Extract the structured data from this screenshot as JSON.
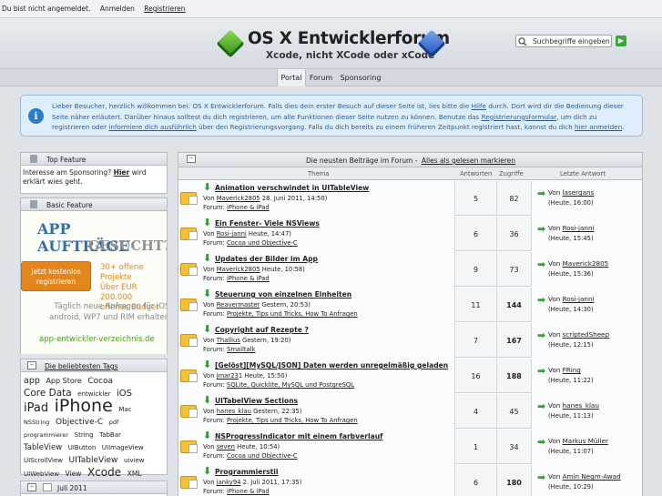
{
  "topbar": {
    "status": "Du bist nicht angemeldet.",
    "login": "Anmelden",
    "register": "Registrieren"
  },
  "header": {
    "title": "OS X Entwicklerforum",
    "subtitle": "Xcode, nicht XCode oder xCode"
  },
  "search": {
    "placeholder": "Suchbegriffe eingeben",
    "go": "▶"
  },
  "nav": {
    "tabs": [
      {
        "label": "Portal"
      },
      {
        "label": "Forum"
      },
      {
        "label": "Sponsoring"
      }
    ]
  },
  "info": {
    "p1": "Lieber Besucher, herzlich willkommen bei: OS X Entwicklerforum. Falls dies dein erster Besuch auf dieser Seite ist, lies bitte die ",
    "help": "Hilfe",
    "p2": " durch. Dort wird dir die Bedienung dieser Seite näher erläutert. Darüber hinaus solltest du dich registrieren, um alle Funktionen dieser Seite nutzen zu können. Benutze das ",
    "form": "Registrierungsformular",
    "p3": ", um dich zu registrieren oder ",
    "more": "informiere dich ausführlich",
    "p4": " über den Registrierungsvorgang. Falls du dich bereits zu einem früheren Zeitpunkt registriert hast, kannst du dich ",
    "login": "hier anmelden",
    "p5": "."
  },
  "sidebar": {
    "top_feature": {
      "title": "Top Feature",
      "text1": "Interesse am Sponsoring? ",
      "link": "Hier",
      "text2": " wird erklärt wies geht."
    },
    "basic_feature": {
      "title": "Basic Feature",
      "ad_line1": "APP AUFTRÄGE",
      "ad_line2": "GESUCHT?",
      "ad_button": "Jetzt kostenlos registrieren",
      "ad_offer1": "30+ offene Projekte",
      "ad_offer2": "Über EUR 200.000",
      "ad_offer3": "offenes Budget",
      "ad_text1": "Täglich neue Anfragen für iOS,",
      "ad_text2": "android, WP7 und RIM erhalten:",
      "ad_url": "app-entwickler-verzeichnis.de"
    },
    "tags": {
      "title": "Die beliebtesten Tags",
      "items": [
        {
          "t": "app",
          "s": 9.5
        },
        {
          "t": "App Store",
          "s": 8
        },
        {
          "t": "Cocoa",
          "s": 9
        },
        {
          "t": "Core Data",
          "s": 10.5
        },
        {
          "t": "entwickler",
          "s": 7
        },
        {
          "t": "iOS",
          "s": 10
        },
        {
          "t": "iPad",
          "s": 13
        },
        {
          "t": "iPhone",
          "s": 19
        },
        {
          "t": "Mac",
          "s": 7
        },
        {
          "t": "NSString",
          "s": 6.5
        },
        {
          "t": "Objective-C",
          "s": 9
        },
        {
          "t": "pdf",
          "s": 6.5
        },
        {
          "t": "programmierer",
          "s": 6.5
        },
        {
          "t": "String",
          "s": 7
        },
        {
          "t": "TabBar",
          "s": 7
        },
        {
          "t": "TableView",
          "s": 8.5
        },
        {
          "t": "UIButton",
          "s": 7
        },
        {
          "t": "UIImageView",
          "s": 7
        },
        {
          "t": "UIScrollView",
          "s": 7
        },
        {
          "t": "UITableView",
          "s": 9
        },
        {
          "t": "uiview",
          "s": 7
        },
        {
          "t": "UIWebView",
          "s": 7
        },
        {
          "t": "View",
          "s": 7.5
        },
        {
          "t": "Xcode",
          "s": 12
        },
        {
          "t": "XML",
          "s": 7.5
        }
      ]
    },
    "calendar": {
      "title": "Juli 2011"
    }
  },
  "main": {
    "heading": "Die neusten Beiträge im Forum - ",
    "mark_read": "Alles als gelesen markieren",
    "columns": {
      "topic": "Thema",
      "replies": "Antworten",
      "views": "Zugriffe",
      "last": "Letzte Antwort"
    },
    "by": "Von ",
    "forum_label": "Forum: ",
    "rows": [
      {
        "title": "Animation verschwindet in UITableView",
        "author": "Maverick2805",
        "date": " 28. Juni 2011, 14:50)",
        "date_prefix": "",
        "forum": "iPhone & iPad",
        "replies": "5",
        "views": "82",
        "last_by": "lasergans",
        "last_time": "(Heute, 16:00)"
      },
      {
        "title": "Ein Fenster- Viele NSViews",
        "author": "Rosi-janni",
        "date": " Heute, 14:47)",
        "forum": "Cocoa und Objective-C",
        "replies": "6",
        "views": "36",
        "last_by": "Rosi-janni",
        "last_time": "(Heute, 15:45)"
      },
      {
        "title": "Updates der Bilder im App",
        "author": "Maverick2805",
        "date": " Heute, 10:58)",
        "forum": "iPhone & iPad",
        "replies": "9",
        "views": "73",
        "last_by": "Maverick2805",
        "last_time": "(Heute, 15:36)"
      },
      {
        "title": "Steuerung von einzelnen Einheiten",
        "author": "Reavermaster",
        "date": " Gestern, 20:53)",
        "forum": "Projekte, Tips und Tricks, How To Anfragen",
        "replies": "11",
        "views": "144",
        "last_by": "Rosi-janni",
        "last_time": "(Heute, 14:30)"
      },
      {
        "title": "Copyright auf Rezepte ?",
        "author": "Thallius",
        "date": " Gestern, 19:20)",
        "forum": "Smalltalk",
        "replies": "7",
        "views": "167",
        "last_by": "scriptedSheep",
        "last_time": "(Heute, 12:15)"
      },
      {
        "title": "[Gelöst][MySQL/JSON] Daten werden unregelmäßig geladen",
        "author": "jmar23",
        "date": "1 Heute, 15:50)",
        "forum": "SQLite, Quicklite, MySQL und PostgreSQL",
        "replies": "16",
        "views": "188",
        "last_by": "FRing",
        "last_time": "(Heute, 11:22)"
      },
      {
        "title": "UITabelView Sections",
        "author": "hanes_klau",
        "date": " Gestern, 22:35)",
        "forum": "Projekte, Tips und Tricks, How To Anfragen",
        "replies": "4",
        "views": "45",
        "last_by": "hanes_klau",
        "last_time": "(Heute, 11:13)"
      },
      {
        "title": "NSProgressIndicator mit einem farbverlauf",
        "author": "seven",
        "date": " Heute, 10:54)",
        "forum": "Cocoa und Objective-C",
        "replies": "1",
        "views": "34",
        "last_by": "Markus Müller",
        "last_time": "(Heute, 11:07)"
      },
      {
        "title": "Programmierstil",
        "author": "janky94",
        "date": " 2. Juli 2011, 17:35)",
        "forum": "iPhone & iPad",
        "replies": "6",
        "views": "180",
        "last_by": "Amin Negm-Awad",
        "last_time": "(Heute, 10:29)"
      }
    ]
  }
}
